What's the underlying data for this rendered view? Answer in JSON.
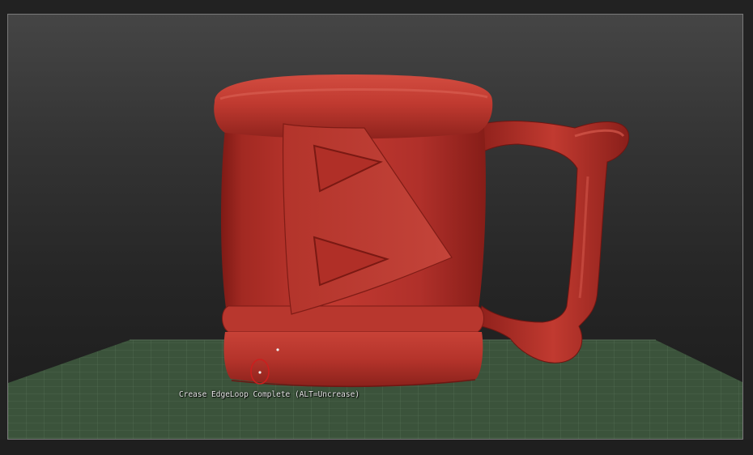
{
  "viewport": {
    "status_message": "Crease EdgeLoop Complete (ALT=Uncrease)",
    "model": {
      "name": "mug",
      "material_color": "#b3302a"
    },
    "floor_grid_color": "#3f5a3f",
    "cursor_ring_color": "#cc1e1e"
  },
  "colors": {
    "background_top": "#454545",
    "background_bottom": "#1b1b1b",
    "frame_border": "#7a7a7a"
  }
}
